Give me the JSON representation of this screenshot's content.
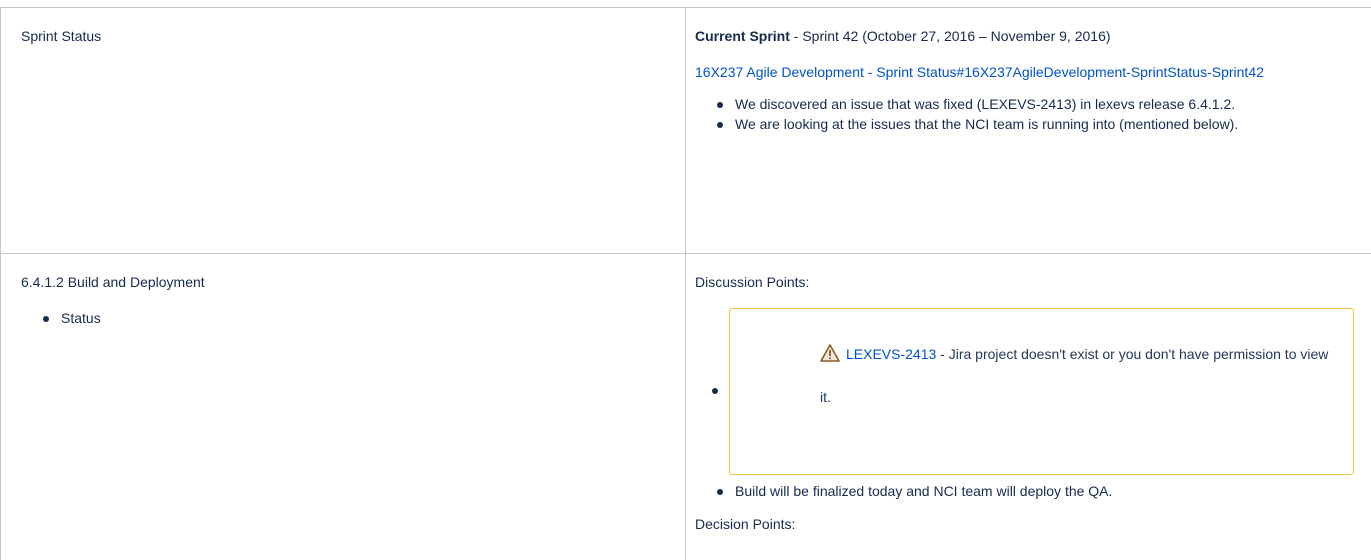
{
  "sprint_status": {
    "label": "Sprint Status",
    "current_sprint_label": "Current Sprint",
    "current_sprint_value": "-  Sprint 42 (October 27, 2016 – November 9, 2016)",
    "link_text": "16X237 Agile Development - Sprint Status#16X237AgileDevelopment-SprintStatus-Sprint42",
    "bullets": [
      "We discovered an issue that was fixed (LEXEVS-2413) in lexevs release 6.4.1.2.",
      "We are looking at the issues that the NCI team is running into (mentioned below)."
    ]
  },
  "build_deploy": {
    "label": "6.4.1.2 Build and Deployment",
    "bullets": [
      "Status"
    ],
    "discussion_label": "Discussion Points:",
    "jira": {
      "key": "LEXEVS-2413",
      "message": " - Jira project doesn't exist or you don't have permission to view it.",
      "icon": "warning-icon"
    },
    "bullets_after": [
      "Build will be finalized today and NCI team will deploy the QA."
    ],
    "decision_label": "Decision Points:"
  },
  "colors": {
    "link": "#0052cc",
    "text": "#172b4d",
    "border": "#c1c7d0",
    "warning_border": "#f6c342"
  }
}
